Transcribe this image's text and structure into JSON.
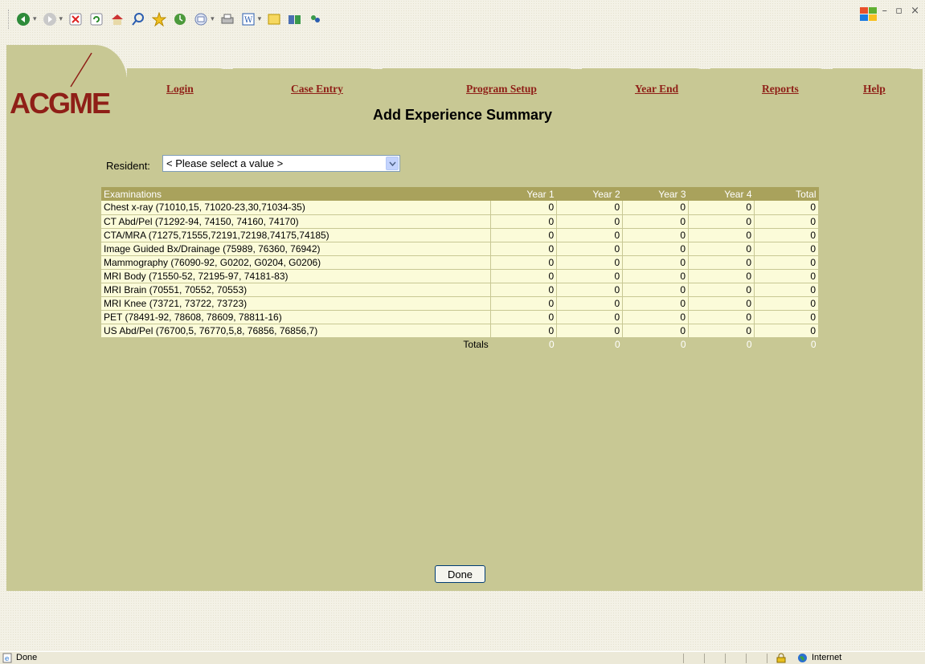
{
  "browser": {
    "status_text": "Done",
    "zone_text": "Internet"
  },
  "header": {
    "logo_text": "ACGME",
    "nav": [
      {
        "label": "Login"
      },
      {
        "label": "Case Entry"
      },
      {
        "label": "Program Setup"
      },
      {
        "label": "Year End"
      },
      {
        "label": "Reports"
      },
      {
        "label": "Help"
      }
    ]
  },
  "page": {
    "title": "Add Experience Summary",
    "resident_label": "Resident:",
    "resident_value": "< Please select a value >",
    "done_label": "Done"
  },
  "table": {
    "headers": [
      "Examinations",
      "Year 1",
      "Year 2",
      "Year 3",
      "Year 4",
      "Total"
    ],
    "rows": [
      {
        "name": "Chest x-ray (71010,15, 71020-23,30,71034-35)",
        "y1": "0",
        "y2": "0",
        "y3": "0",
        "y4": "0",
        "total": "0"
      },
      {
        "name": "CT Abd/Pel (71292-94, 74150, 74160, 74170)",
        "y1": "0",
        "y2": "0",
        "y3": "0",
        "y4": "0",
        "total": "0"
      },
      {
        "name": "CTA/MRA (71275,71555,72191,72198,74175,74185)",
        "y1": "0",
        "y2": "0",
        "y3": "0",
        "y4": "0",
        "total": "0"
      },
      {
        "name": "Image Guided Bx/Drainage (75989, 76360, 76942)",
        "y1": "0",
        "y2": "0",
        "y3": "0",
        "y4": "0",
        "total": "0"
      },
      {
        "name": "Mammography (76090-92, G0202, G0204, G0206)",
        "y1": "0",
        "y2": "0",
        "y3": "0",
        "y4": "0",
        "total": "0"
      },
      {
        "name": "MRI Body (71550-52, 72195-97, 74181-83)",
        "y1": "0",
        "y2": "0",
        "y3": "0",
        "y4": "0",
        "total": "0"
      },
      {
        "name": "MRI Brain (70551, 70552, 70553)",
        "y1": "0",
        "y2": "0",
        "y3": "0",
        "y4": "0",
        "total": "0"
      },
      {
        "name": "MRI Knee (73721, 73722, 73723)",
        "y1": "0",
        "y2": "0",
        "y3": "0",
        "y4": "0",
        "total": "0"
      },
      {
        "name": "PET (78491-92, 78608, 78609, 78811-16)",
        "y1": "0",
        "y2": "0",
        "y3": "0",
        "y4": "0",
        "total": "0"
      },
      {
        "name": "US Abd/Pel (76700,5, 76770,5,8, 76856, 76856,7)",
        "y1": "0",
        "y2": "0",
        "y3": "0",
        "y4": "0",
        "total": "0"
      }
    ],
    "totals": {
      "label": "Totals",
      "y1": "0",
      "y2": "0",
      "y3": "0",
      "y4": "0",
      "total": "0"
    }
  }
}
